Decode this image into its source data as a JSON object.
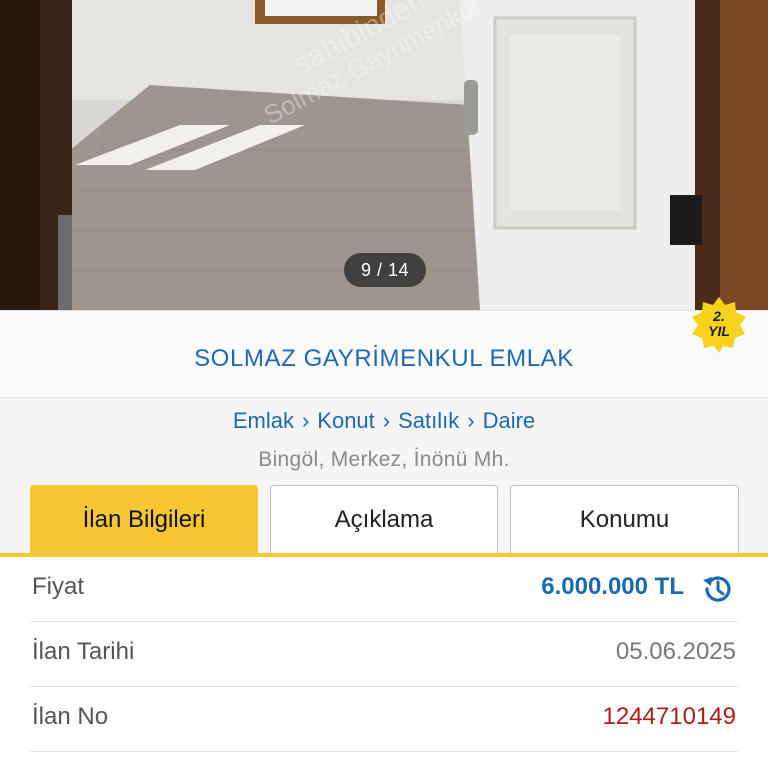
{
  "gallery": {
    "counter": "9 / 14",
    "watermark_line1": "sahibinden",
    "watermark_line2": "Solmaz Gayrimenkul"
  },
  "store": {
    "name": "SOLMAZ GAYRİMENKUL EMLAK",
    "badge_line1": "2.",
    "badge_line2": "YIL"
  },
  "breadcrumb": {
    "items": [
      "Emlak",
      "Konut",
      "Satılık",
      "Daire"
    ],
    "separator": "›"
  },
  "location": "Bingöl, Merkez, İnönü Mh.",
  "tabs": [
    {
      "label": "İlan Bilgileri",
      "active": true
    },
    {
      "label": "Açıklama",
      "active": false
    },
    {
      "label": "Konumu",
      "active": false
    }
  ],
  "details": {
    "price_label": "Fiyat",
    "price_value": "6.000.000 TL",
    "date_label": "İlan Tarihi",
    "date_value": "05.06.2025",
    "no_label": "İlan No",
    "no_value": "1244710149"
  },
  "colors": {
    "accent": "#f7c634",
    "link": "#1d68b3",
    "ad_number": "#b01c1c"
  }
}
